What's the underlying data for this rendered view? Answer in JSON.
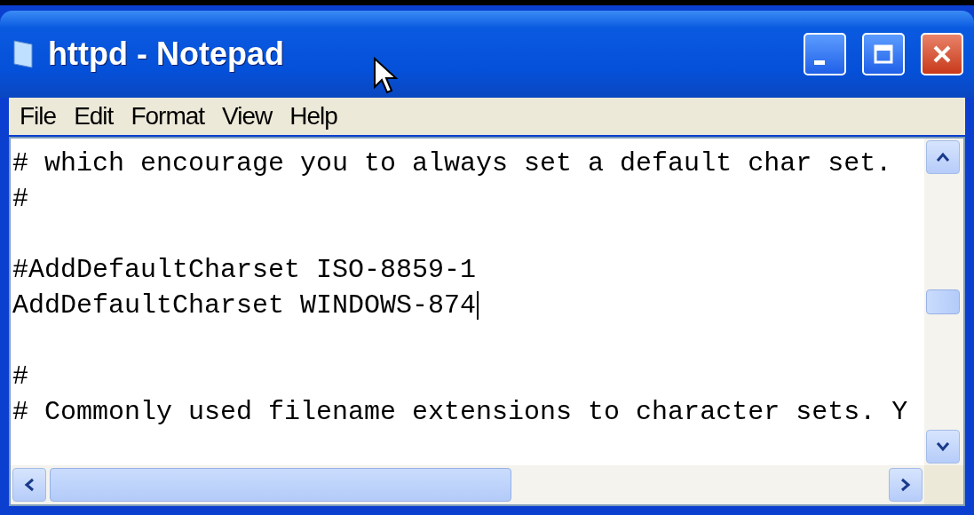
{
  "window": {
    "title": "httpd - Notepad"
  },
  "menu": [
    {
      "label": "File"
    },
    {
      "label": "Edit"
    },
    {
      "label": "Format"
    },
    {
      "label": "View"
    },
    {
      "label": "Help"
    }
  ],
  "lines": [
    {
      "kind": "text",
      "text": "# which encourage you to always set a default char set.",
      "caret": false
    },
    {
      "kind": "text",
      "text": "#",
      "caret": false
    },
    {
      "kind": "blank"
    },
    {
      "kind": "text",
      "text": "#AddDefaultCharset ISO-8859-1",
      "caret": false
    },
    {
      "kind": "text",
      "text": "AddDefaultCharset WINDOWS-874",
      "caret": true
    },
    {
      "kind": "blank"
    },
    {
      "kind": "text",
      "text": "#",
      "caret": false
    },
    {
      "kind": "text",
      "text": "# Commonly used filename extensions to character sets. Y",
      "caret": false
    }
  ]
}
